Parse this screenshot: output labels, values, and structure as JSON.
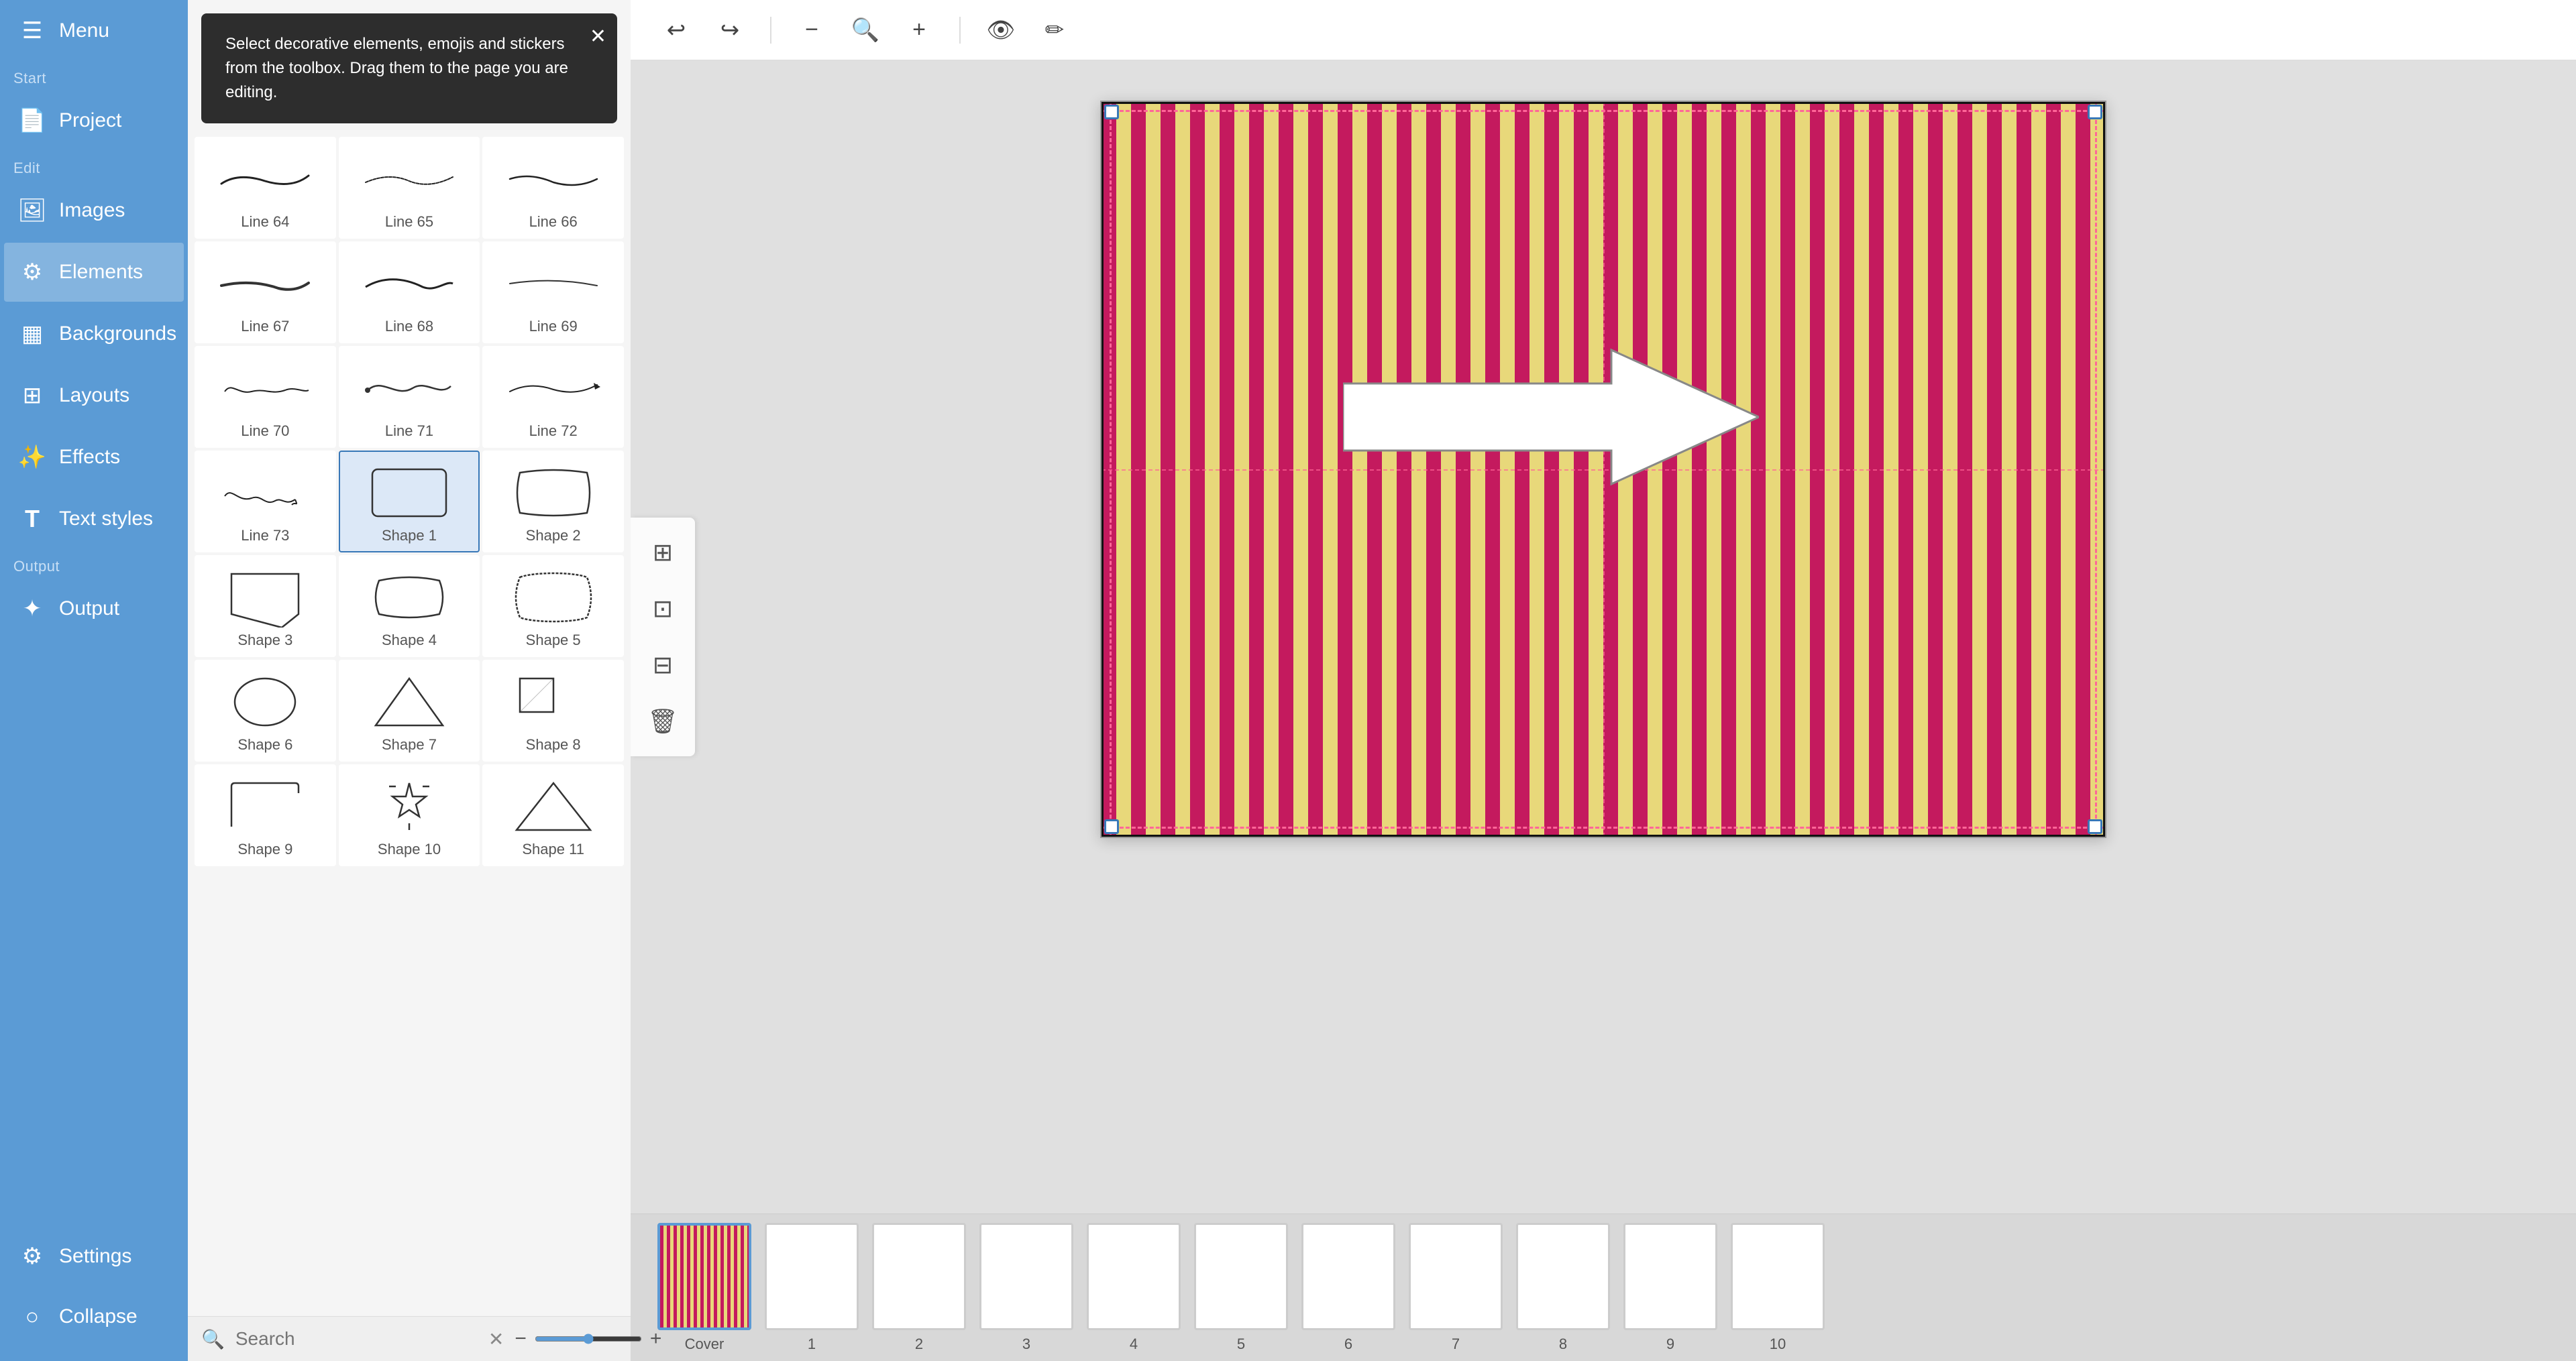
{
  "sidebar": {
    "menu_label": "Menu",
    "sections": {
      "start": "Start",
      "edit": "Edit",
      "output": "Output"
    },
    "items": [
      {
        "id": "project",
        "label": "Project",
        "icon": "📄"
      },
      {
        "id": "images",
        "label": "Images",
        "icon": "🖼"
      },
      {
        "id": "elements",
        "label": "Elements",
        "icon": "⚙"
      },
      {
        "id": "backgrounds",
        "label": "Backgrounds",
        "icon": "▦"
      },
      {
        "id": "layouts",
        "label": "Layouts",
        "icon": "▦"
      },
      {
        "id": "effects",
        "label": "Effects",
        "icon": "✨"
      },
      {
        "id": "text_styles",
        "label": "Text styles",
        "icon": "T"
      },
      {
        "id": "output",
        "label": "Output",
        "icon": "✦"
      }
    ],
    "bottom_items": [
      {
        "id": "settings",
        "label": "Settings",
        "icon": "⚙"
      },
      {
        "id": "collapse",
        "label": "Collapse",
        "icon": "○"
      }
    ]
  },
  "tooltip": {
    "text": "Select decorative elements, emojis and stickers from the toolbox. Drag them to the page you are editing."
  },
  "elements": [
    {
      "id": "line64",
      "label": "Line 64",
      "type": "line"
    },
    {
      "id": "line65",
      "label": "Line 65",
      "type": "line"
    },
    {
      "id": "line66",
      "label": "Line 66",
      "type": "line"
    },
    {
      "id": "line67",
      "label": "Line 67",
      "type": "line"
    },
    {
      "id": "line68",
      "label": "Line 68",
      "type": "line"
    },
    {
      "id": "line69",
      "label": "Line 69",
      "type": "line"
    },
    {
      "id": "line70",
      "label": "Line 70",
      "type": "line"
    },
    {
      "id": "line71",
      "label": "Line 71",
      "type": "line"
    },
    {
      "id": "line72",
      "label": "Line 72",
      "type": "line"
    },
    {
      "id": "line73",
      "label": "Line 73",
      "type": "line"
    },
    {
      "id": "shape1",
      "label": "Shape 1",
      "type": "shape",
      "selected": true
    },
    {
      "id": "shape2",
      "label": "Shape 2",
      "type": "shape"
    },
    {
      "id": "shape3",
      "label": "Shape 3",
      "type": "shape"
    },
    {
      "id": "shape4",
      "label": "Shape 4",
      "type": "shape"
    },
    {
      "id": "shape5",
      "label": "Shape 5",
      "type": "shape"
    },
    {
      "id": "shape6",
      "label": "Shape 6",
      "type": "shape"
    },
    {
      "id": "shape7",
      "label": "Shape 7",
      "type": "shape"
    },
    {
      "id": "shape8",
      "label": "Shape 8",
      "type": "shape"
    },
    {
      "id": "shape9",
      "label": "Shape 9",
      "type": "shape_partial"
    },
    {
      "id": "shape10",
      "label": "Shape 10",
      "type": "shape_partial"
    },
    {
      "id": "shape11",
      "label": "Shape 11",
      "type": "shape_partial"
    }
  ],
  "search": {
    "placeholder": "Search",
    "value": ""
  },
  "toolbar": {
    "undo_label": "↩",
    "redo_label": "↪",
    "zoom_out": "−",
    "zoom_in": "+"
  },
  "canvas": {
    "title": "Cover"
  },
  "pages": [
    {
      "label": "Cover",
      "type": "cover"
    },
    {
      "label": "1",
      "type": "blank"
    },
    {
      "label": "2",
      "type": "blank"
    },
    {
      "label": "3",
      "type": "blank"
    },
    {
      "label": "4",
      "type": "blank"
    },
    {
      "label": "5",
      "type": "blank"
    },
    {
      "label": "6",
      "type": "blank"
    },
    {
      "label": "7",
      "type": "blank"
    },
    {
      "label": "8",
      "type": "blank"
    },
    {
      "label": "9",
      "type": "blank"
    },
    {
      "label": "10",
      "type": "blank"
    }
  ],
  "left_vtoolbar": [
    {
      "id": "vtool1",
      "icon": "⊞"
    },
    {
      "id": "vtool2",
      "icon": "⊡"
    },
    {
      "id": "vtool3",
      "icon": "⊟"
    },
    {
      "id": "vtool4",
      "icon": "🗑"
    }
  ]
}
